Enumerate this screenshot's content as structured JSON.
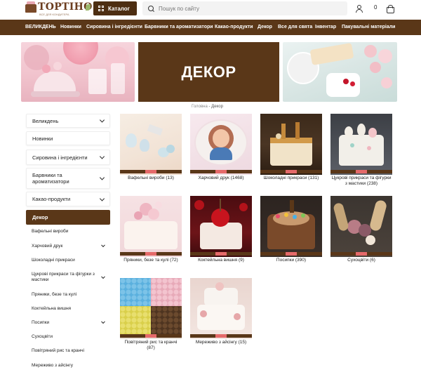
{
  "header": {
    "logo_text": "ТОРТІНО",
    "logo_sub": "ВСЕ ДЛЯ КОНДИТЕРА",
    "catalog_label": "Каталог",
    "search_placeholder": "Пошук по сайту",
    "cart_count": "0"
  },
  "nav": {
    "items": [
      "ВЕЛИКДЕНЬ",
      "Новинки",
      "Сировина і інгредієнти",
      "Барвники та ароматизатори",
      "Какао-продукти",
      "Декор",
      "Все для свята",
      "Інвентар",
      "Пакувальні матеріали"
    ]
  },
  "banner": {
    "title": "ДЕКОР"
  },
  "breadcrumb": {
    "home": "Головна",
    "separator": " - ",
    "current": "Декор"
  },
  "sidebar": {
    "items": [
      "Великдень",
      "Новинки",
      "Сировина і інгредієнти",
      "Барвники та ароматизатори",
      "Какао-продукти",
      "Декор"
    ],
    "sub_items": [
      "Вафельні вироби",
      "Харчовий друк",
      "Шоколадні прикраси",
      "Цукрові прикраси та фігурки з мастики",
      "Пряники, безе та кулі",
      "Коктейльна вишня",
      "Посипки",
      "Сухоцвіти",
      "Повітряний рис та кранчі",
      "Мереживо з айсінгу"
    ]
  },
  "products": [
    "Вафельні вироби (13)",
    "Харчовий друк (1468)",
    "Шоколадні прикраси (131)",
    "Цукрові прикраси та фігурки з мастики (238)",
    "Пряники, безе та кулі (72)",
    "Коктейльна вишня (9)",
    "Посипки (390)",
    "Сухоцвіти (6)",
    "Повітряний рис та кранчі (87)",
    "Мереживо з айсінгу (15)"
  ],
  "colors": {
    "brand_brown": "#5a3718",
    "accent_pink": "#e56a6a"
  }
}
